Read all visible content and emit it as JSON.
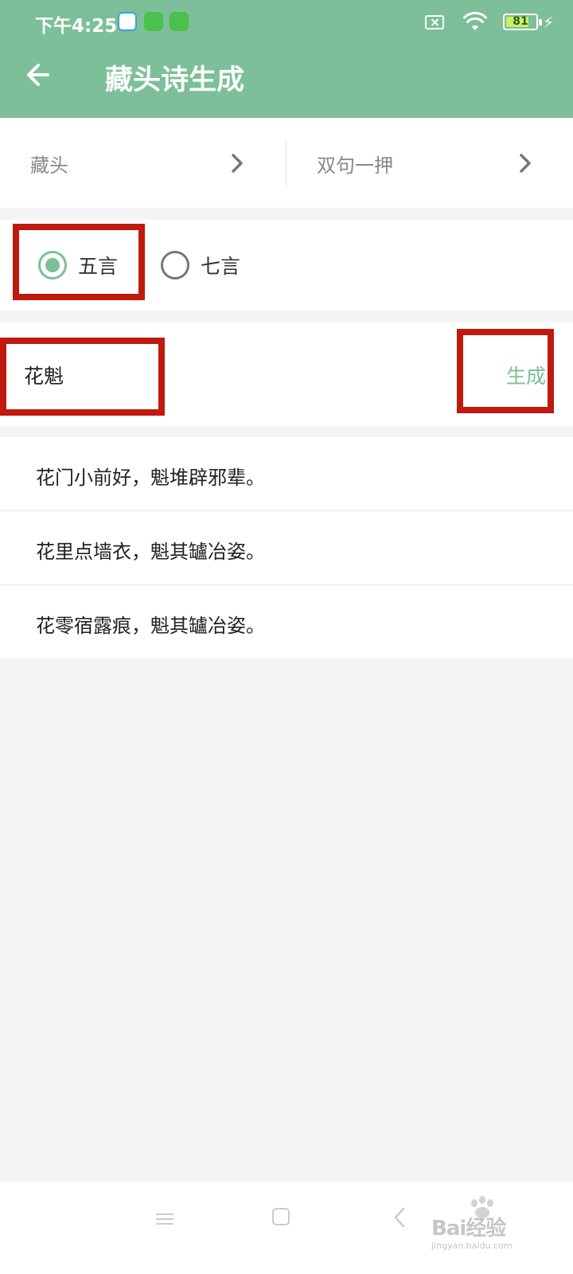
{
  "status_bar": {
    "time": "下午4:25",
    "battery": "81",
    "battery_level_percent": 81
  },
  "header": {
    "title": "藏头诗生成",
    "color": "#7dbf98"
  },
  "selectors": {
    "left": "藏头",
    "right": "双句一押"
  },
  "radio": {
    "five": "五言",
    "seven": "七言",
    "selected": "五言"
  },
  "input": {
    "value": "花魁",
    "generate": "生成"
  },
  "results": [
    "花门小前好，魁堆辟邪辈。",
    "花里点墙衣，魁其罏冶姿。",
    "花零宿露痕，魁其罏冶姿。"
  ],
  "watermark": {
    "main": "Bai经验",
    "sub": "jingyan.baidu.com"
  },
  "icons": [
    "back-arrow-icon",
    "chevron-right-icon",
    "wifi-icon",
    "battery-icon",
    "charging-icon",
    "menu-icon",
    "home-icon",
    "back-icon"
  ]
}
